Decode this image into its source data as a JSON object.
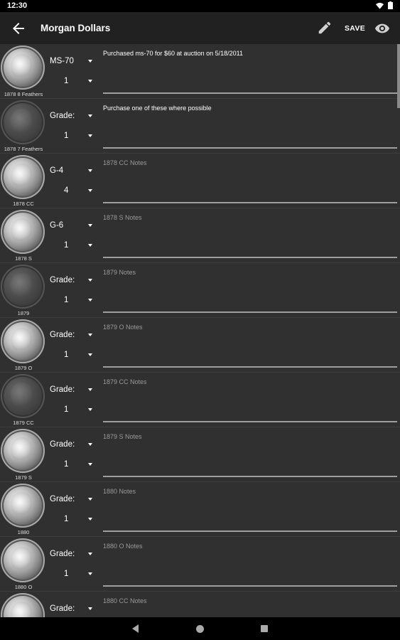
{
  "status": {
    "time": "12:30"
  },
  "toolbar": {
    "title": "Morgan Dollars",
    "save_label": "SAVE"
  },
  "coins": [
    {
      "label": "1878 8 Feathers",
      "grade": "MS-70",
      "qty": "1",
      "notes": "Purchased ms-70 for $60 at auction on 5/18/2011",
      "notes_is_placeholder": false,
      "dim": false
    },
    {
      "label": "1878 7 Feathers",
      "grade": "Grade:",
      "qty": "1",
      "notes": "Purchase one of these where possible",
      "notes_is_placeholder": false,
      "dim": true
    },
    {
      "label": "1878 CC",
      "grade": "G-4",
      "qty": "4",
      "notes": "1878 CC Notes",
      "notes_is_placeholder": true,
      "dim": false
    },
    {
      "label": "1878 S",
      "grade": "G-6",
      "qty": "1",
      "notes": "1878 S Notes",
      "notes_is_placeholder": true,
      "dim": false
    },
    {
      "label": "1879",
      "grade": "Grade:",
      "qty": "1",
      "notes": "1879  Notes",
      "notes_is_placeholder": true,
      "dim": true
    },
    {
      "label": "1879 O",
      "grade": "Grade:",
      "qty": "1",
      "notes": "1879 O Notes",
      "notes_is_placeholder": true,
      "dim": false
    },
    {
      "label": "1879 CC",
      "grade": "Grade:",
      "qty": "1",
      "notes": "1879 CC Notes",
      "notes_is_placeholder": true,
      "dim": true
    },
    {
      "label": "1879 S",
      "grade": "Grade:",
      "qty": "1",
      "notes": "1879 S Notes",
      "notes_is_placeholder": true,
      "dim": false
    },
    {
      "label": "1880",
      "grade": "Grade:",
      "qty": "1",
      "notes": "1880  Notes",
      "notes_is_placeholder": true,
      "dim": false
    },
    {
      "label": "1880 O",
      "grade": "Grade:",
      "qty": "1",
      "notes": "1880 O Notes",
      "notes_is_placeholder": true,
      "dim": false
    },
    {
      "label": "",
      "grade": "Grade:",
      "qty": "",
      "notes": "1880 CC Notes",
      "notes_is_placeholder": true,
      "dim": false
    }
  ],
  "icons": {
    "back": "arrow-back-icon",
    "edit": "pencil-icon",
    "view": "eye-icon",
    "wifi": "wifi-icon",
    "battery": "battery-icon"
  }
}
